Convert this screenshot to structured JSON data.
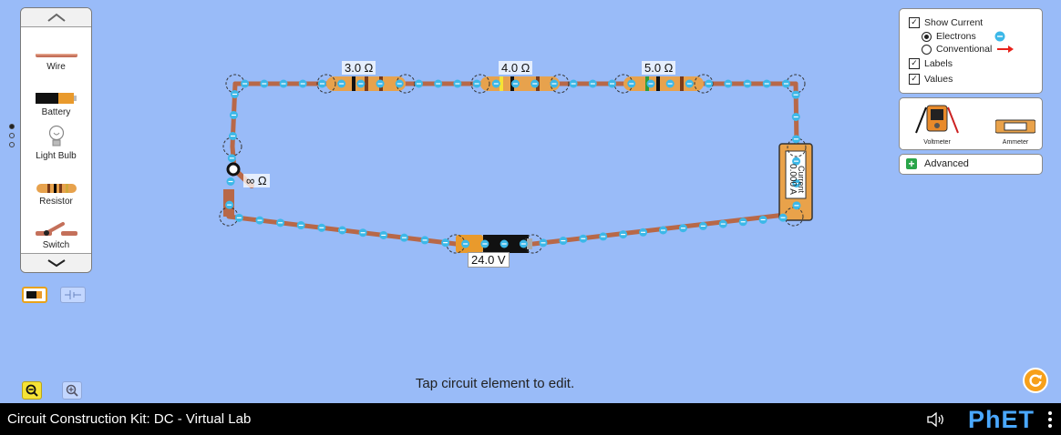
{
  "toolbox": {
    "items": [
      {
        "label": "Wire",
        "icon": "wire-icon"
      },
      {
        "label": "Battery",
        "icon": "battery-icon"
      },
      {
        "label": "Light Bulb",
        "icon": "light-bulb-icon"
      },
      {
        "label": "Resistor",
        "icon": "resistor-icon"
      },
      {
        "label": "Switch",
        "icon": "switch-icon"
      }
    ],
    "pages_total": 3,
    "page_active": 1
  },
  "view_toggle": {
    "selected": "lifelike",
    "options": [
      "lifelike-view",
      "schematic-view"
    ]
  },
  "display_panel": {
    "show_current": {
      "label": "Show Current",
      "checked": true
    },
    "current_type": [
      {
        "label": "Electrons",
        "selected": true
      },
      {
        "label": "Conventional",
        "selected": false
      }
    ],
    "labels": {
      "label": "Labels",
      "checked": true
    },
    "values": {
      "label": "Values",
      "checked": true
    }
  },
  "sensor_panel": {
    "voltmeter": "Voltmeter",
    "ammeter": "Ammeter"
  },
  "advanced": {
    "label": "Advanced"
  },
  "circuit": {
    "resistor1": "3.0 Ω",
    "resistor2": "4.0 Ω",
    "resistor3": "5.0 Ω",
    "switch_resistance": "∞ Ω",
    "battery": "24.0 V",
    "ammeter_reading": "0.000 A",
    "ammeter_title": "Current"
  },
  "hint": "Tap circuit element to edit.",
  "footer": {
    "title": "Circuit Construction Kit: DC - Virtual Lab",
    "logo": "PhET"
  },
  "colors": {
    "background": "#99bbf8",
    "wire": "#c47a55",
    "electron": "#3cb8e8",
    "zoom_selected": "#f5e236",
    "reset": "#f7a01a",
    "phet_blue": "#4aa8ff"
  }
}
